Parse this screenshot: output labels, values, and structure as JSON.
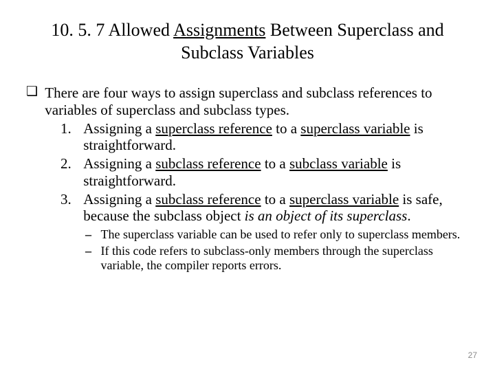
{
  "title": {
    "pre": "10. 5. 7 Allowed ",
    "u": "Assignments",
    "post": " Between Superclass and Subclass Variables"
  },
  "bullet_glyph": "❑",
  "intro": "There are four ways to assign superclass and subclass references to variables of superclass and subclass types.",
  "items": [
    {
      "num": "1.",
      "pre": "Assigning a ",
      "u1": "superclass reference",
      "mid": " to a ",
      "u2": "superclass variable",
      "post": " is straightforward."
    },
    {
      "num": "2.",
      "pre": "Assigning a ",
      "u1": "subclass reference",
      "mid": " to a ",
      "u2": "subclass variable",
      "post": " is straightforward."
    },
    {
      "num": "3.",
      "pre": "Assigning a ",
      "u1": "subclass reference",
      "mid": " to a ",
      "u2": "superclass variable",
      "post_a": " is safe, because the subclass object ",
      "ital": "is an object of its superclass",
      "post_b": "."
    }
  ],
  "dashes": [
    "The superclass variable can be used to refer only to superclass members.",
    "If this code refers to subclass-only members through the superclass variable, the compiler reports errors."
  ],
  "page": "27"
}
